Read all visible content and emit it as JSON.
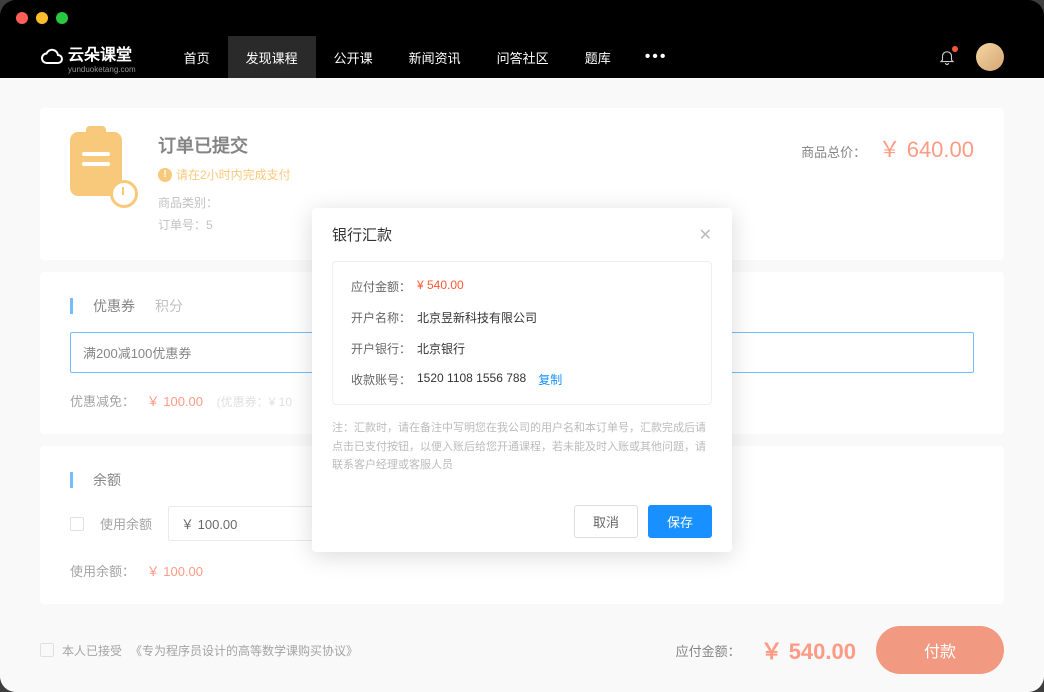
{
  "logo": {
    "text": "云朵课堂",
    "sub": "yunduoketang.com"
  },
  "nav": {
    "items": [
      "首页",
      "发现课程",
      "公开课",
      "新闻资讯",
      "问答社区",
      "题库"
    ],
    "active_index": 1
  },
  "order": {
    "title": "订单已提交",
    "warning": "请在2小时内完成支付",
    "meta_category": "商品类别：",
    "meta_number": "订单号：5",
    "total_label": "商品总价：",
    "total_amount": "￥ 640.00"
  },
  "coupon": {
    "title": "优惠券",
    "tab": "积分",
    "selected": "满200减100优惠券",
    "discount_label": "优惠减免：",
    "discount_value": "￥ 100.00",
    "discount_note": "(优惠券：¥ 10"
  },
  "balance": {
    "title": "余额",
    "use_label": "使用余额",
    "input_value": "￥ 100.00",
    "used_label": "使用余额：",
    "used_value": "￥ 100.00"
  },
  "footer": {
    "agree_prefix": "本人已接受",
    "agree_link": "《专为程序员设计的高等数学课购买协议》",
    "pay_label": "应付金额：",
    "pay_amount": "￥ 540.00",
    "pay_button": "付款"
  },
  "modal": {
    "title": "银行汇款",
    "rows": [
      {
        "label": "应付金额：",
        "value": "¥ 540.00",
        "price": true
      },
      {
        "label": "开户名称：",
        "value": "北京昱新科技有限公司"
      },
      {
        "label": "开户银行：",
        "value": "北京银行"
      },
      {
        "label": "收款账号：",
        "value": "1520 1108 1556 788",
        "copy": true
      }
    ],
    "copy_text": "复制",
    "note": "注：汇款时，请在备注中写明您在我公司的用户名和本订单号，汇款完成后请点击已支付按钮，以便入账后给您开通课程，若未能及时入账或其他问题，请联系客户经理或客服人员",
    "cancel": "取消",
    "save": "保存"
  }
}
